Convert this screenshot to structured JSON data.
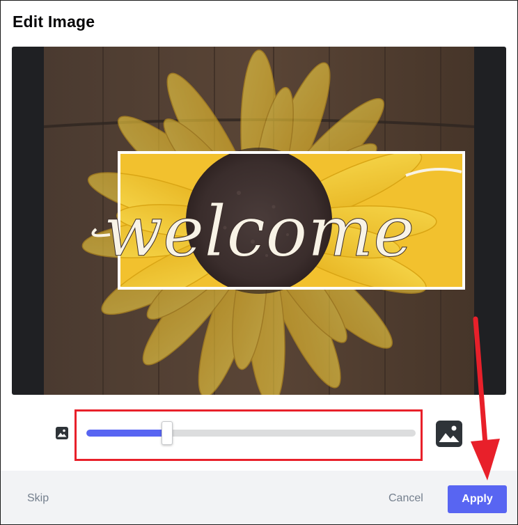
{
  "dialog": {
    "title": "Edit Image"
  },
  "image": {
    "text": "welcome",
    "icon": "sunflower-welcome-sign-photo"
  },
  "zoom_slider": {
    "value_fraction": 0.245,
    "min_icon": "image-small-icon",
    "max_icon": "image-large-icon",
    "fill_color": "#5865f2",
    "highlight_color": "#e8202a"
  },
  "footer": {
    "skip_label": "Skip",
    "cancel_label": "Cancel",
    "apply_label": "Apply",
    "apply_color": "#5865f2"
  },
  "annotation": {
    "arrow_color": "#e8202a"
  }
}
